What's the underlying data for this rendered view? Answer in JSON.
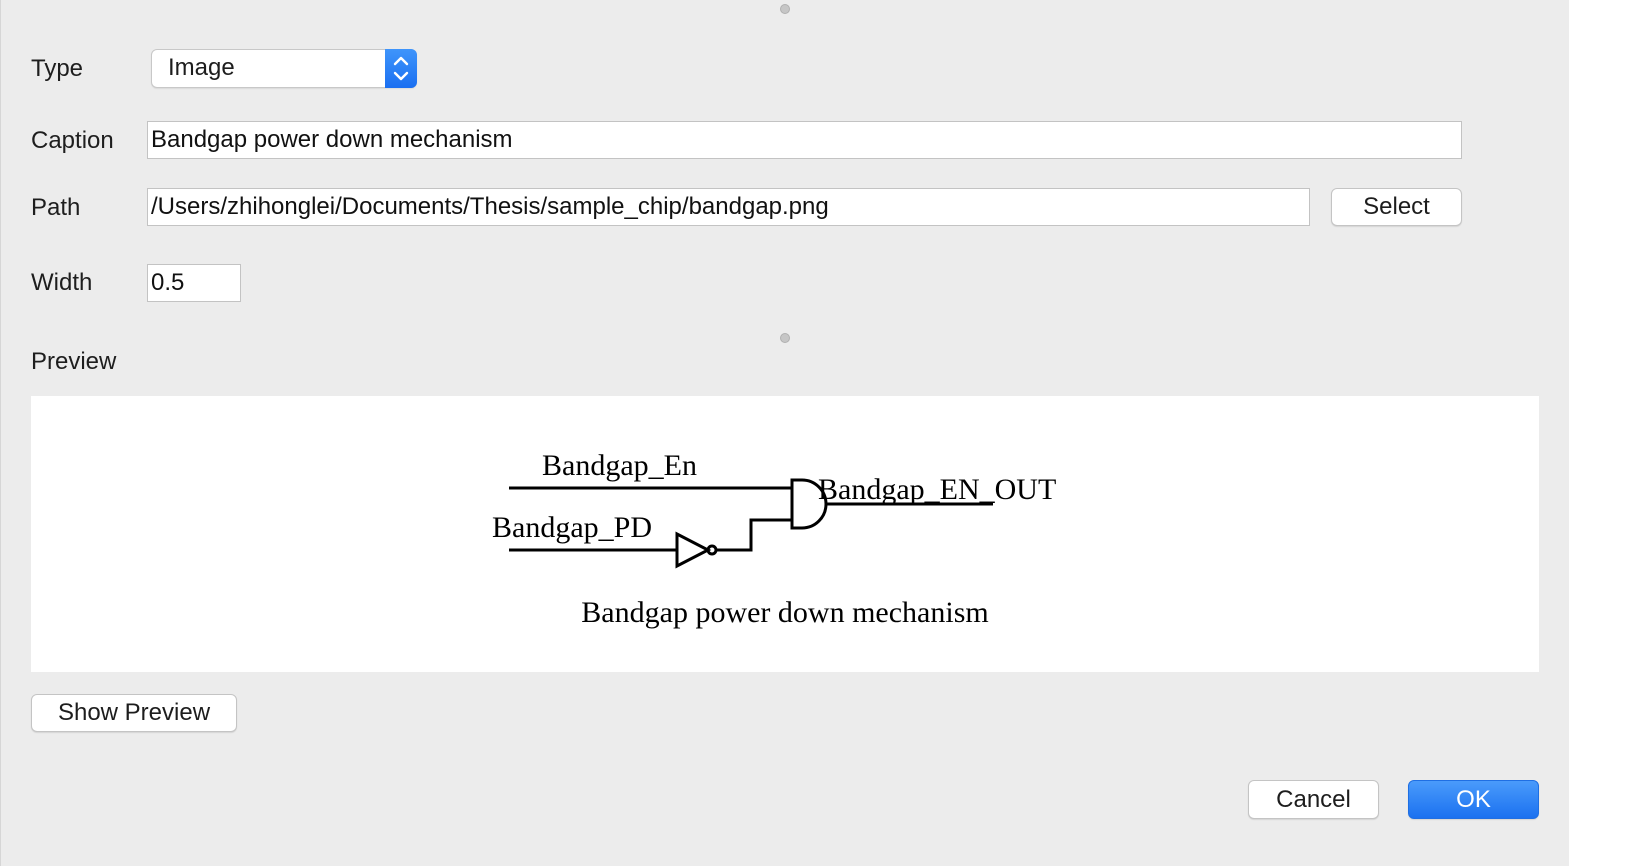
{
  "form": {
    "type_label": "Type",
    "type_value": "Image",
    "caption_label": "Caption",
    "caption_value": "Bandgap power down mechanism",
    "path_label": "Path",
    "path_value": "/Users/zhihonglei/Documents/Thesis/sample_chip/bandgap.png",
    "select_label": "Select",
    "width_label": "Width",
    "width_value": "0.5"
  },
  "preview": {
    "heading": "Preview",
    "diagram": {
      "input_a": "Bandgap_En",
      "input_b": "Bandgap_PD",
      "output": "Bandgap_EN_OUT",
      "caption": "Bandgap power down mechanism"
    },
    "show_preview_label": "Show Preview"
  },
  "footer": {
    "cancel_label": "Cancel",
    "ok_label": "OK"
  },
  "colors": {
    "accent": "#1b71f0",
    "dialog_bg": "#ececec"
  }
}
